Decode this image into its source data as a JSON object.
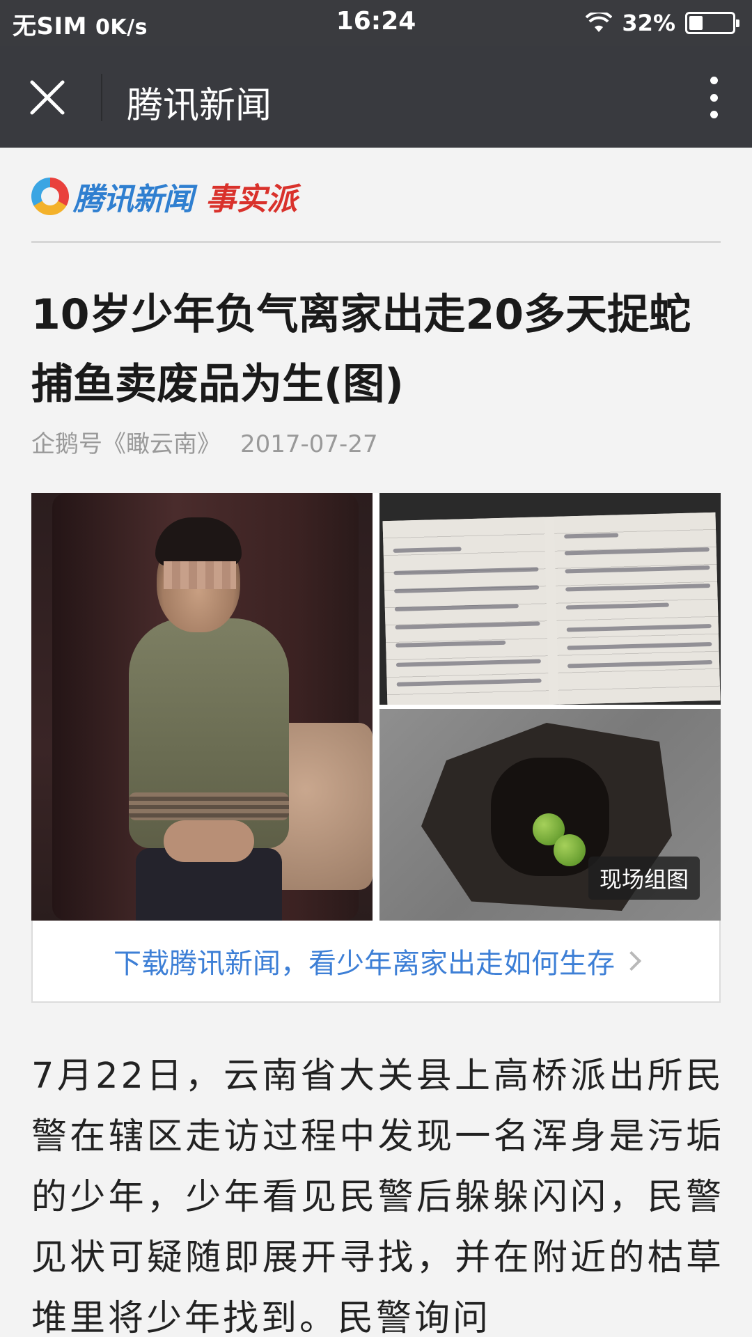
{
  "status_bar": {
    "carrier": "无SIM",
    "speed": "0K/s",
    "time": "16:24",
    "battery": "32%",
    "battery_level": 0.32
  },
  "nav": {
    "title": "腾讯新闻",
    "close_icon": "close-icon",
    "more_icon": "more-vertical-icon"
  },
  "logo": {
    "brand": "腾讯新闻",
    "tag": "事实派"
  },
  "article": {
    "title": "10岁少年负气离家出走20多天捉蛇捕鱼卖废品为生(图)",
    "source": "企鹅号《瞰云南》",
    "date": "2017-07-27",
    "photo_label": "现场组图",
    "download_text": "下载腾讯新闻，看少年离家出走如何生存",
    "body": "7月22日，云南省大关县上高桥派出所民警在辖区走访过程中发现一名浑身是污垢的少年，少年看见民警后躲躲闪闪，民警见状可疑随即展开寻找，并在附近的枯草堆里将少年找到。民警询问"
  },
  "colors": {
    "status_bg": "#3a3b3f",
    "nav_bg": "#393a3f",
    "link_blue": "#3d7fd6",
    "brand_blue": "#2f7fd0",
    "brand_red": "#d9312b"
  }
}
